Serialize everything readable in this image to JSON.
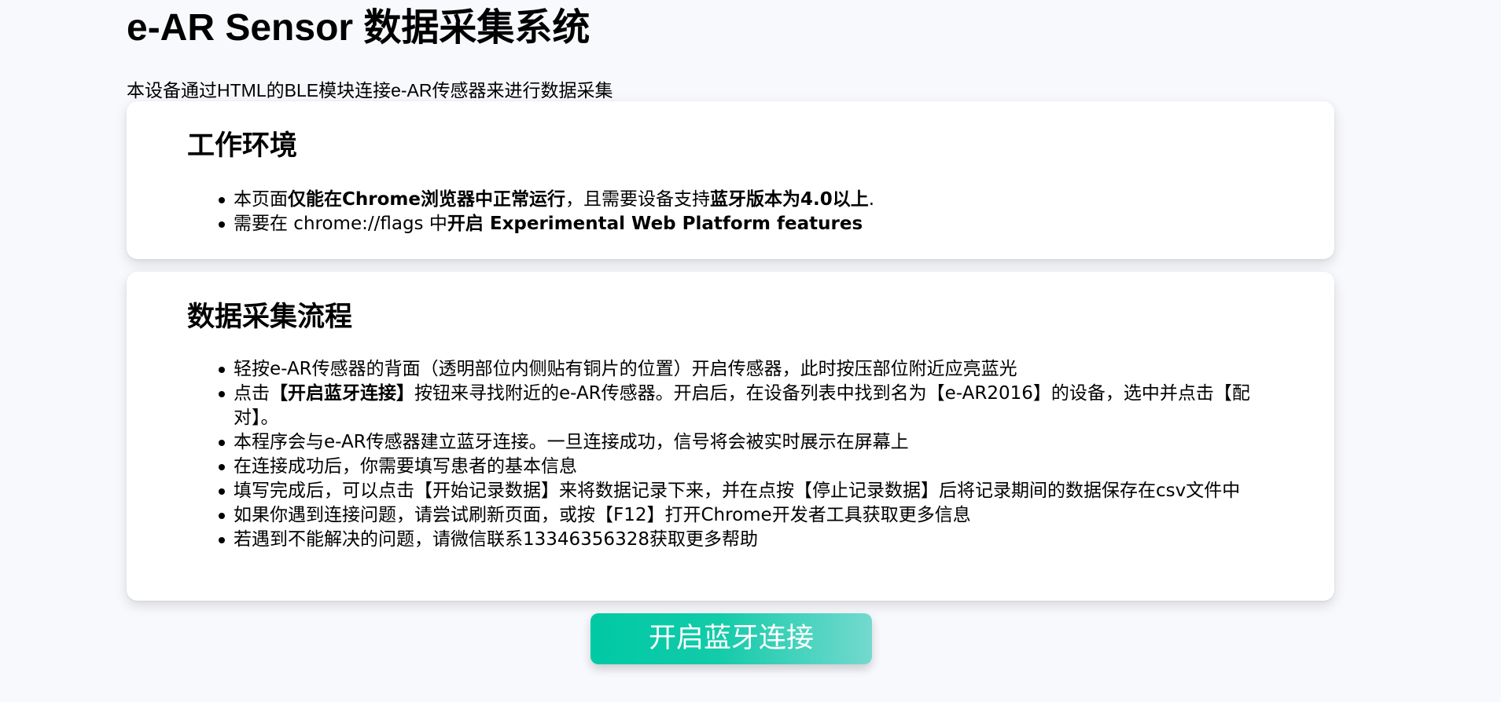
{
  "header": {
    "title": "e-AR Sensor 数据采集系统",
    "subtitle": "本设备通过HTML的BLE模块连接e-AR传感器来进行数据采集"
  },
  "environment": {
    "heading": "工作环境",
    "items": [
      {
        "part1": "本页面",
        "bold1": "仅能在Chrome浏览器中正常运行",
        "part2": "，且需要设备支持",
        "bold2": "蓝牙版本为4.0以上",
        "part3": "."
      },
      {
        "part1": "需要在 chrome://flags 中",
        "bold1": "开启 Experimental Web Platform features"
      }
    ]
  },
  "process": {
    "heading": "数据采集流程",
    "items": [
      {
        "text": "轻按e-AR传感器的背面（透明部位内侧贴有铜片的位置）开启传感器，此时按压部位附近应亮蓝光"
      },
      {
        "pre": "点击",
        "bold": "【开启蓝牙连接】",
        "post": "按钮来寻找附近的e-AR传感器。开启后，在设备列表中找到名为【e-AR2016】的设备，选中并点击【配对】。"
      },
      {
        "text": "本程序会与e-AR传感器建立蓝牙连接。一旦连接成功，信号将会被实时展示在屏幕上"
      },
      {
        "text": "在连接成功后，你需要填写患者的基本信息"
      },
      {
        "text": "填写完成后，可以点击【开始记录数据】来将数据记录下来，并在点按【停止记录数据】后将记录期间的数据保存在csv文件中"
      },
      {
        "text": "如果你遇到连接问题，请尝试刷新页面，或按【F12】打开Chrome开发者工具获取更多信息"
      },
      {
        "text": "若遇到不能解决的问题，请微信联系13346356328获取更多帮助"
      }
    ]
  },
  "actions": {
    "connect_label": "开启蓝牙连接"
  },
  "colors": {
    "page_background": "#f8f9fd",
    "card_background": "#ffffff",
    "button_gradient_start": "#00c9a4",
    "button_gradient_end": "#74d9cf",
    "button_text": "#ffffff"
  }
}
